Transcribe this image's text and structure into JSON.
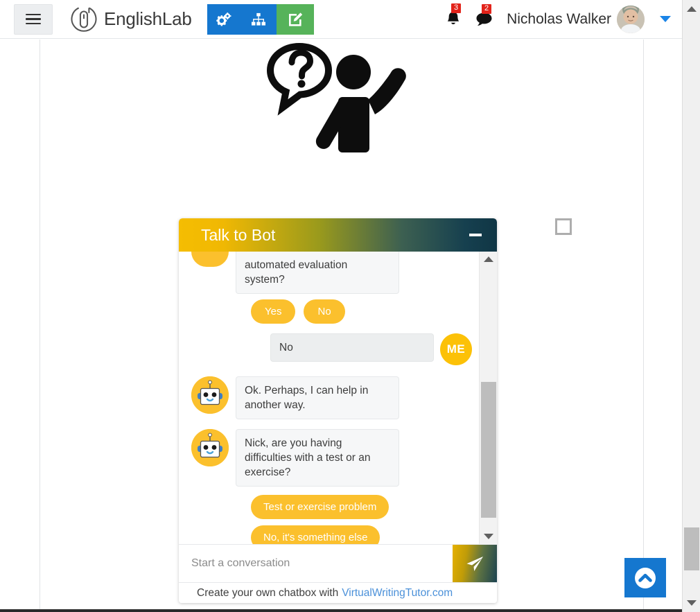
{
  "navbar": {
    "menu_toggle": "hamburger-menu",
    "brand": "EnglishLab",
    "actions": [
      {
        "name": "settings-gears",
        "style": "blue"
      },
      {
        "name": "sitemap",
        "style": "blue"
      },
      {
        "name": "compose-edit",
        "style": "green"
      }
    ],
    "notifications": {
      "icon": "bell-icon",
      "count": "3"
    },
    "messages": {
      "icon": "comment-icon",
      "count": "2"
    },
    "user_name": "Nicholas Walker",
    "avatar_alt": "user-avatar",
    "caret": "chevron-down-icon"
  },
  "hero": {
    "alt": "person-raising-hand-with-question-mark"
  },
  "chat": {
    "title": "Talk to Bot",
    "minimize_label": "minimize",
    "messages": [
      {
        "id": "m1",
        "from": "bot",
        "text": "automated evaluation system?",
        "clipped": true,
        "avatar": "robot-avatar"
      },
      {
        "id": "q1",
        "type": "quick_replies",
        "layout": "row",
        "options": [
          "Yes",
          "No"
        ]
      },
      {
        "id": "m2",
        "from": "me",
        "text": "No",
        "avatar_initials": "ME"
      },
      {
        "id": "m3",
        "from": "bot",
        "text": "Ok. Perhaps, I can help in another way.",
        "avatar": "robot-avatar"
      },
      {
        "id": "m4",
        "from": "bot",
        "text": "Nick, are you having difficulties with a test or an exercise?",
        "avatar": "robot-avatar"
      },
      {
        "id": "q2",
        "type": "quick_replies",
        "layout": "stack",
        "options": [
          "Test or exercise problem",
          "No, it's something else"
        ]
      }
    ],
    "input_placeholder": "Start a conversation",
    "input_value": "",
    "send_label": "send-icon",
    "footer_text": "Create your own chatbox with",
    "footer_link": "VirtualWritingTutor.com"
  },
  "floating": {
    "scroll_top_label": "scroll-to-top",
    "placeholder_box_label": "empty-placeholder"
  },
  "colors": {
    "brand_blue": "#1577cf",
    "brand_green": "#56b35a",
    "chat_gold": "#f5bd02",
    "chat_teal": "#103645",
    "badge_red": "#e2231a",
    "chip_gold": "#fbc02d",
    "link_blue": "#4a90d9"
  }
}
